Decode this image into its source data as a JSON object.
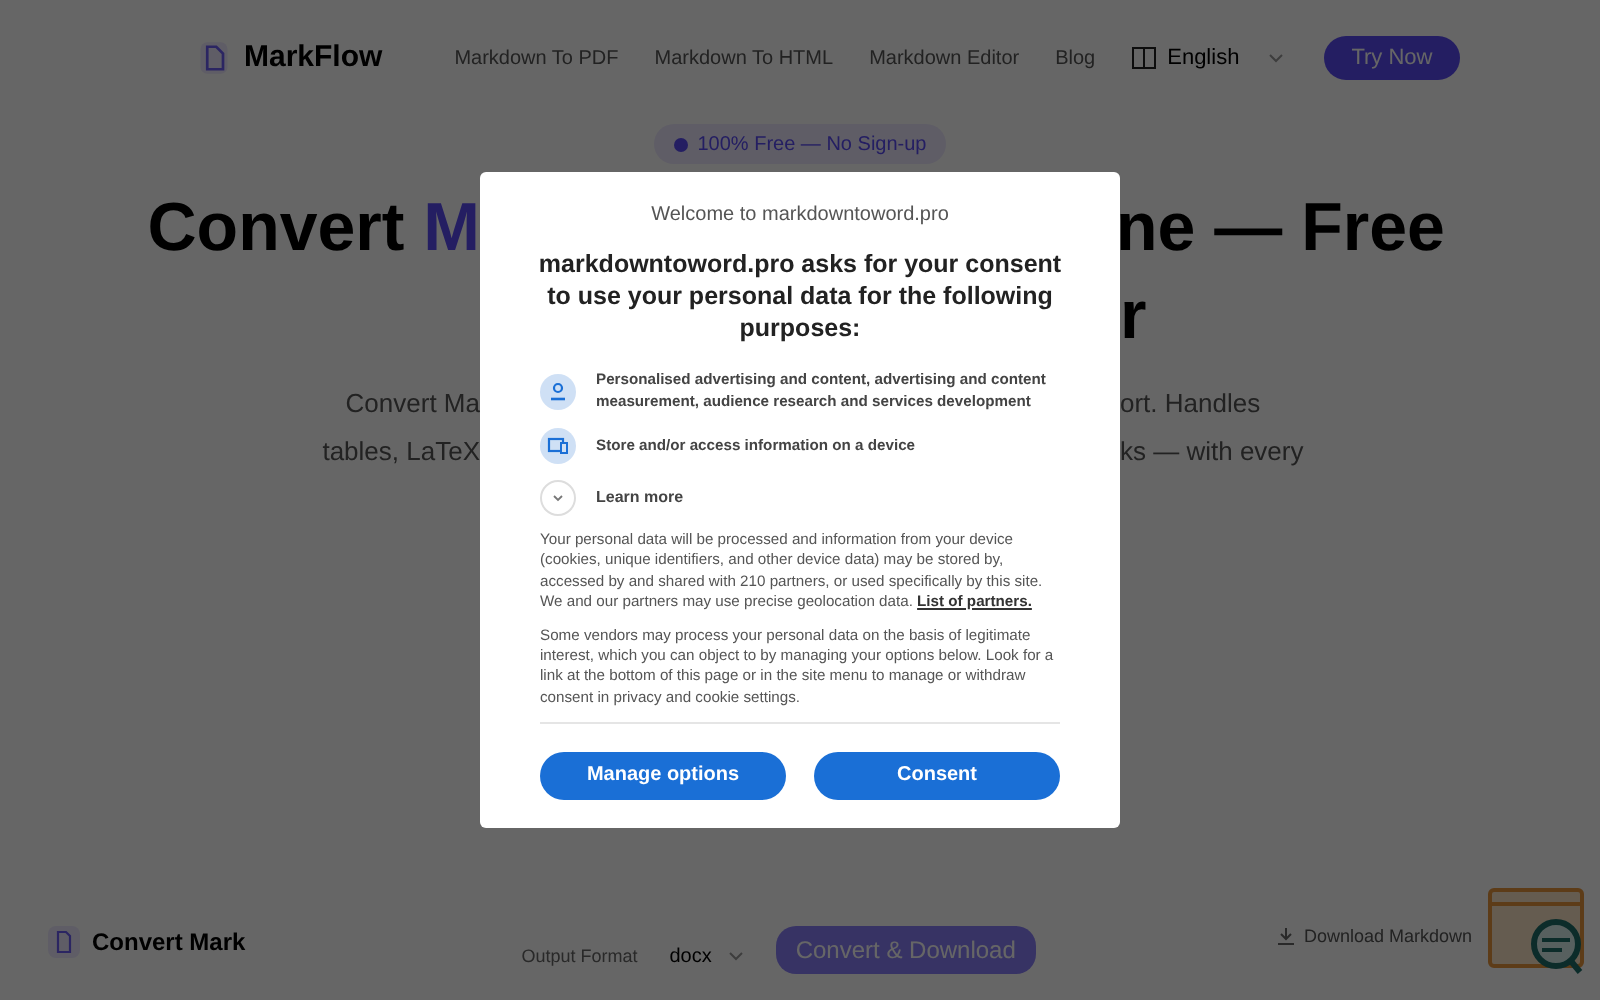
{
  "header": {
    "logo": "MarkFlow",
    "nav": [
      {
        "label": "Markdown To PDF"
      },
      {
        "label": "Markdown To HTML"
      },
      {
        "label": "Markdown Editor"
      },
      {
        "label": "Blog"
      }
    ],
    "language": "English",
    "cta": "Try Now"
  },
  "badge": "100% Free — No Sign-up",
  "hero": {
    "title_left": "Convert ",
    "title_left_accent": "M",
    "title_right": "ne — Free",
    "title_right_2": "r",
    "subtitle_left": [
      "Convert Ma",
      "tables, LaTeX"
    ],
    "subtitle_right": [
      "ort. Handles",
      "ks — with every"
    ]
  },
  "tool_bar": {
    "title": "Convert Mark",
    "output_label": "Output Format",
    "format": "docx",
    "convert_button": "Convert & Download",
    "download_link": "Download Markdown"
  },
  "consent": {
    "site_label": "Welcome to markdowntoword.pro",
    "heading": "markdowntoword.pro asks for your consent to use your personal data for the following purposes:",
    "purposes": [
      {
        "kind": "person",
        "text": "Personalised advertising and content, advertising and content measurement, audience research and services development"
      },
      {
        "kind": "device",
        "text": "Store and/or access information on a device"
      }
    ],
    "learn_more": "Learn more",
    "paragraph_1": "Your personal data will be processed and information from your device (cookies, unique identifiers, and other device data) may be stored by, accessed by and shared with 210 partners, or used specifically by this site. We and our partners may use precise geolocation data.",
    "partners_link": "List of partners.",
    "paragraph_2": "Some vendors may process your personal data on the basis of legitimate interest, which you can object to by managing your options below. Look for a link at the bottom of this page or in the site menu to manage or withdraw consent in privacy and cookie settings.",
    "buttons": [
      {
        "label": "Manage options"
      },
      {
        "label": "Consent"
      }
    ]
  }
}
